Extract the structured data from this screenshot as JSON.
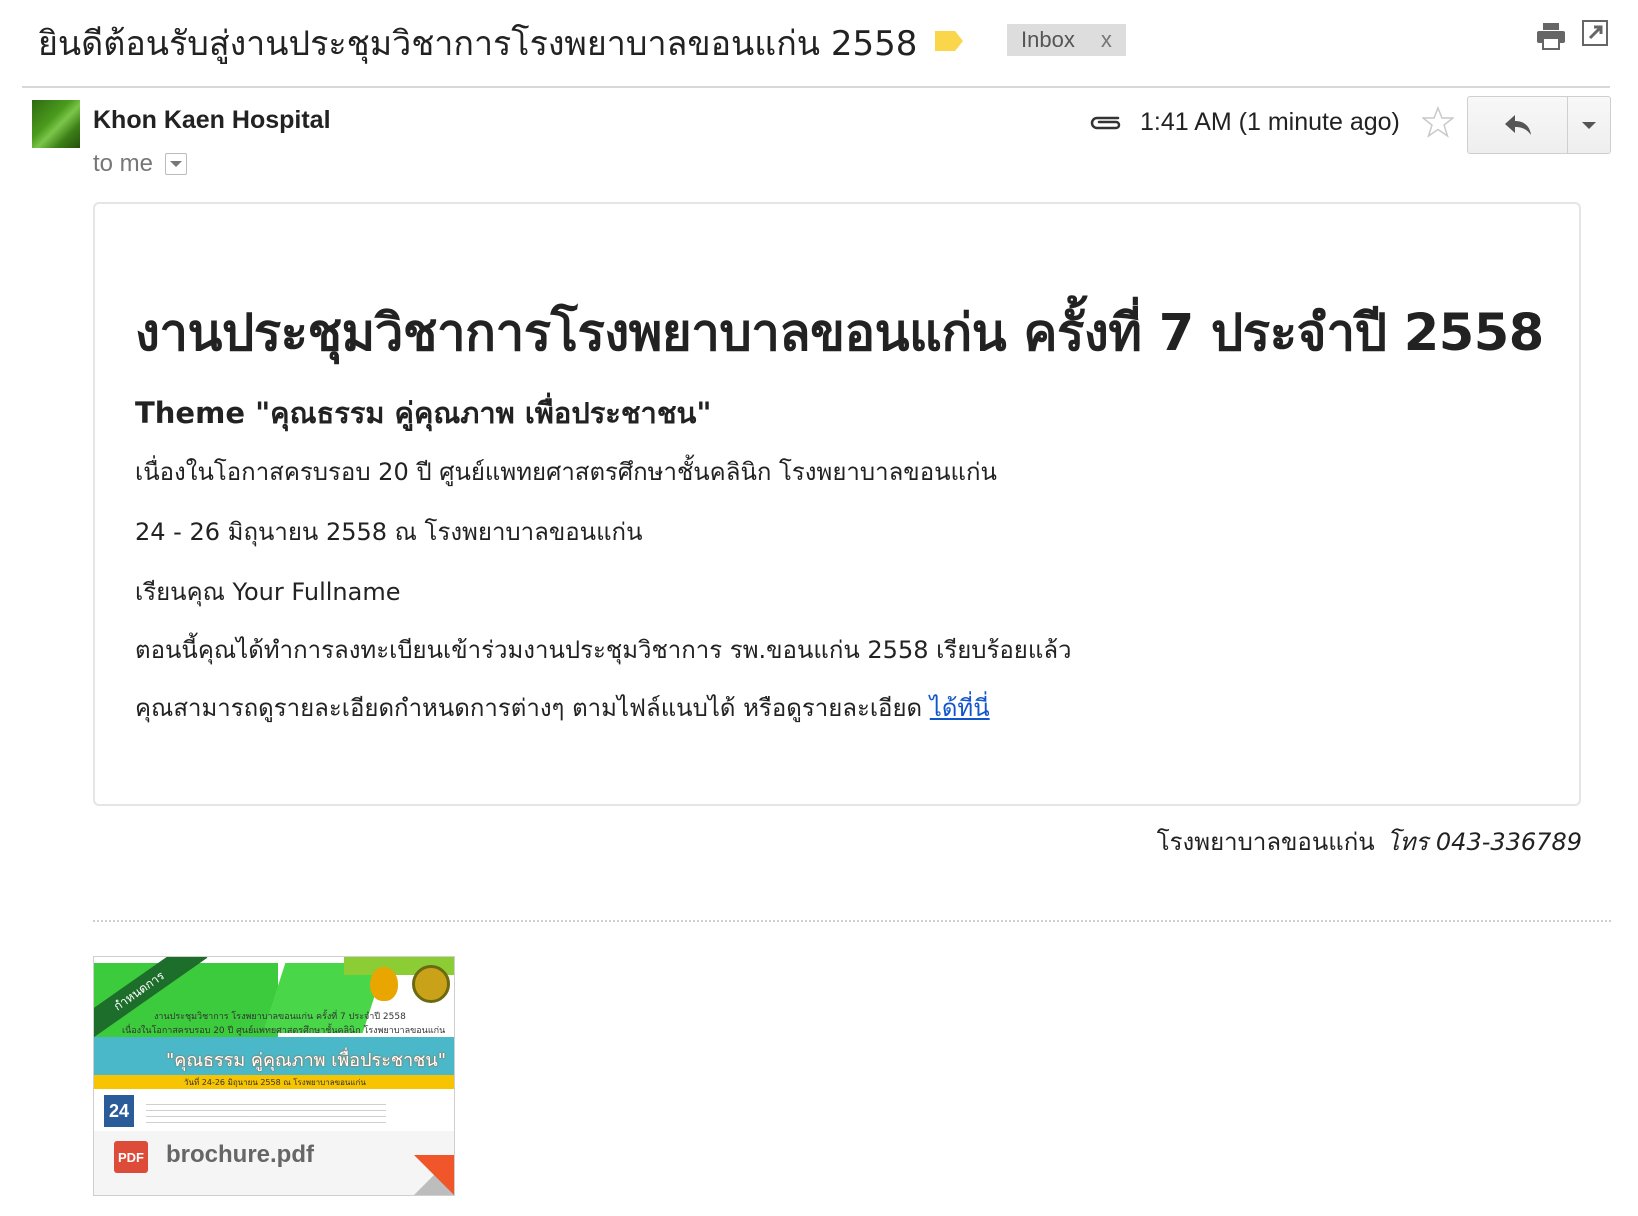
{
  "subject": {
    "text": "ยินดีต้อนรับสู่งานประชุมวิชาการโรงพยาบาลขอนแก่น 2558",
    "label_color": "#f9d64a",
    "inbox_label": "Inbox",
    "inbox_remove": "x"
  },
  "sender": {
    "name": "Khon Kaen Hospital",
    "to": "to me",
    "time": "1:41 AM (1 minute ago)"
  },
  "message": {
    "title": "งานประชุมวิชาการโรงพยาบาลขอนแก่น ครั้งที่ 7 ประจำปี 2558",
    "theme": "Theme \"คุณธรรม คู่คุณภาพ เพื่อประชาชน\"",
    "line1": "เนื่องในโอกาสครบรอบ 20 ปี ศูนย์แพทยศาสตรศึกษาชั้นคลินิก โรงพยาบาลขอนแก่น",
    "line2": "24 - 26 มิถุนายน 2558 ณ โรงพยาบาลขอนแก่น",
    "line3": "เรียนคุณ Your Fullname",
    "line4": "ตอนนี้คุณได้ทำการลงทะเบียนเข้าร่วมงานประชุมวิชาการ รพ.ขอนแก่น 2558 เรียบร้อยแล้ว",
    "line5": "คุณสามารถดูรายละเอียดกำหนดการต่างๆ ตามไฟล์แนบได้ หรือดูรายละเอียด",
    "link": "ได้ที่นี่",
    "link_color": "#1155cc"
  },
  "signature": {
    "org": "โรงพยาบาลขอนแก่น",
    "tel": "โทร 043-336789"
  },
  "attachment": {
    "file_name": "brochure.pdf",
    "type_badge": "PDF",
    "thumb_diag": "กำหนดการ",
    "thumb_line1": "งานประชุมวิชาการ โรงพยาบาลขอนแก่น ครั้งที่ 7 ประจำปี 2558",
    "thumb_line2": "เนื่องในโอกาสครบรอบ 20 ปี ศูนย์แพทยศาสตรศึกษาชั้นคลินิก โรงพยาบาลขอนแก่น",
    "thumb_quote": "\"คุณธรรม คู่คุณภาพ เพื่อประชาชน\"",
    "thumb_date": "วันที่ 24-26 มิถุนายน 2558 ณ โรงพยาบาลขอนแก่น",
    "thumb_day": "24"
  },
  "icons": {
    "label": "label-tag-icon",
    "print": "print-icon",
    "popout": "open-in-new-window-icon",
    "attach": "paperclip-icon",
    "star": "star-icon",
    "reply": "reply-icon",
    "more": "chevron-down-icon"
  }
}
